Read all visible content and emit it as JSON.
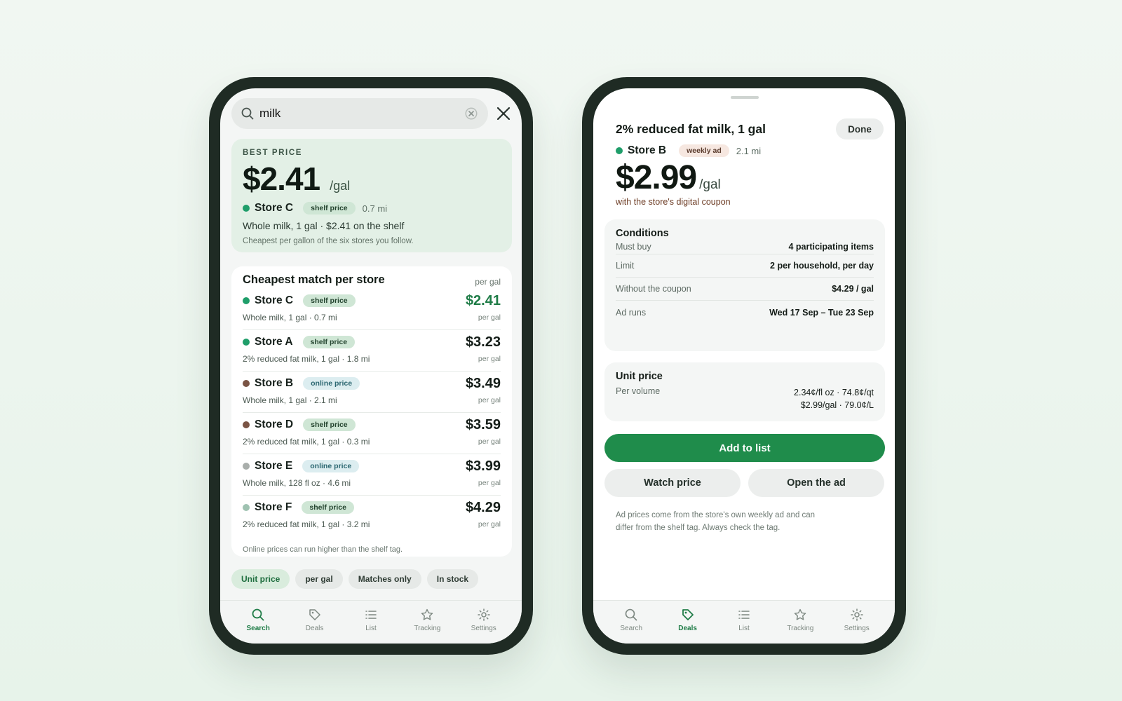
{
  "colors": {
    "accent": "#1f8c4b",
    "best_price_bg": "#e3f0e6",
    "store_dot_green": "#1f9e6a",
    "store_dot_brown": "#7a5444",
    "store_dot_gray": "#a9aeab",
    "store_dot_sage": "#9fc2b1"
  },
  "search_screen": {
    "search": {
      "value": "milk",
      "icon": "search-icon",
      "clear_icon": "clear-circle-icon",
      "close_icon": "close-icon"
    },
    "best_price": {
      "eyebrow": "BEST PRICE",
      "price": "$2.41",
      "unit": "/gal",
      "store": "Store C",
      "tag": "shelf price",
      "distance": "0.7 mi",
      "description": "Whole milk, 1 gal · $2.41 on the shelf",
      "note": "Cheapest per gallon of the six stores you follow."
    },
    "list": {
      "title": "Cheapest match per store",
      "unit_header": "per gal",
      "rows": [
        {
          "store": "Store C",
          "tag": "shelf price",
          "desc": "Whole milk, 1 gal · 0.7 mi",
          "price": "$2.41",
          "unit": "per gal"
        },
        {
          "store": "Store A",
          "tag": "shelf price",
          "desc": "2% reduced fat milk, 1 gal · 1.8 mi",
          "price": "$3.23",
          "unit": "per gal"
        },
        {
          "store": "Store B",
          "tag": "online price",
          "desc": "Whole milk, 1 gal · 2.1 mi",
          "price": "$3.49",
          "unit": "per gal"
        },
        {
          "store": "Store D",
          "tag": "shelf price",
          "desc": "2% reduced fat milk, 1 gal · 0.3 mi",
          "price": "$3.59",
          "unit": "per gal"
        },
        {
          "store": "Store E",
          "tag": "online price",
          "desc": "Whole milk, 128 fl oz · 4.6 mi",
          "price": "$3.99",
          "unit": "per gal"
        },
        {
          "store": "Store F",
          "tag": "shelf price",
          "desc": "2% reduced fat milk, 1 gal · 3.2 mi",
          "price": "$4.29",
          "unit": "per gal"
        }
      ],
      "note": "Online prices can run higher than the shelf tag."
    },
    "chips": [
      "Unit price",
      "per gal",
      "Matches only",
      "In stock"
    ]
  },
  "detail_sheet": {
    "title": "2% reduced fat milk, 1 gal",
    "done_label": "Done",
    "store": "Store B",
    "tag": "weekly ad",
    "distance": "2.1 mi",
    "price": "$2.99",
    "unit": "/gal",
    "coupon_note": "with the store's digital coupon",
    "conditions": {
      "title": "Conditions",
      "rows": [
        {
          "label": "Must buy",
          "value": "4 participating items"
        },
        {
          "label": "Limit",
          "value": "2 per household, per day"
        },
        {
          "label": "Without the coupon",
          "value": "$4.29 / gal"
        },
        {
          "label": "Ad runs",
          "value": "Wed 17 Sep – Tue 23 Sep"
        }
      ]
    },
    "unit_price": {
      "title": "Unit price",
      "label": "Per volume",
      "line1": "2.34¢/fl oz · 74.8¢/qt",
      "line2": "$2.99/gal · 79.0¢/L"
    },
    "add_label": "Add to list",
    "watch_label": "Watch price",
    "open_label": "Open the ad",
    "disclaimer": "Ad prices come from the store's own weekly ad and can differ from the shelf tag. Always check the tag."
  },
  "tabs": [
    {
      "label": "Search",
      "icon": "search-icon"
    },
    {
      "label": "Deals",
      "icon": "tag-icon"
    },
    {
      "label": "List",
      "icon": "list-icon"
    },
    {
      "label": "Tracking",
      "icon": "star-icon"
    },
    {
      "label": "Settings",
      "icon": "gear-icon"
    }
  ],
  "left_active_tab": "Search",
  "right_active_tab": "Deals"
}
